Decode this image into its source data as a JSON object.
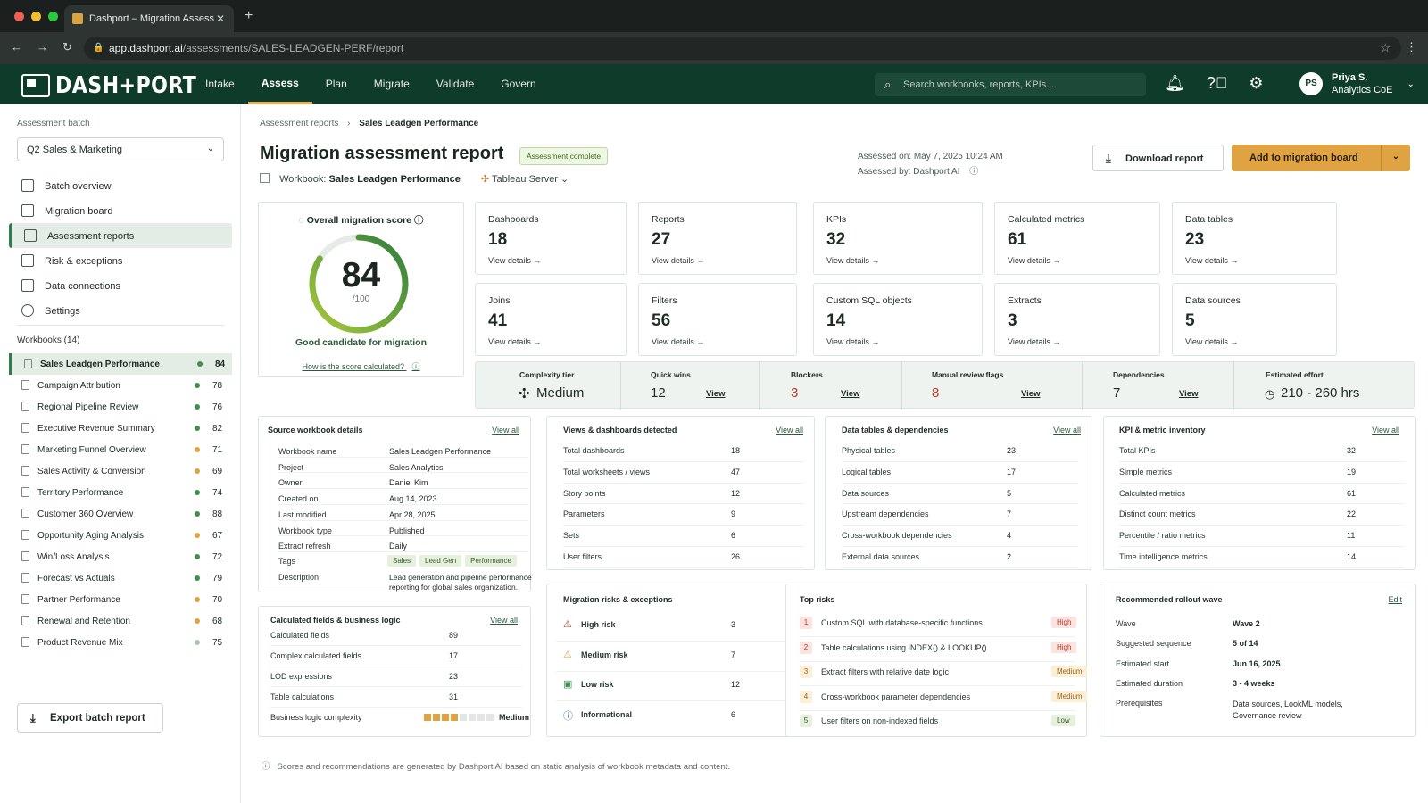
{
  "browser": {
    "tab_title": "Dashport – Migration Assess",
    "url_host": "app.dashport.ai",
    "url_path": "/assessments/SALES-LEADGEN-PERF/report"
  },
  "topnav": {
    "logo": "DASH+PORT",
    "items": [
      "Intake",
      "Assess",
      "Plan",
      "Migrate",
      "Validate",
      "Govern"
    ],
    "search_placeholder": "Search workbooks, reports, KPIs...",
    "user_initials": "PS",
    "user_name": "Priya S.",
    "user_role": "Analytics CoE"
  },
  "sidebar": {
    "batch_label": "Assessment batch",
    "batch_value": "Q2 Sales & Marketing",
    "nav": [
      "Batch overview",
      "Migration board",
      "Assessment reports",
      "Risk & exceptions",
      "Data connections",
      "Settings"
    ],
    "workbooks_label": "Workbooks (14)",
    "workbooks": [
      {
        "name": "Sales Leadgen Performance",
        "score": "84",
        "color": "#3f8f4f"
      },
      {
        "name": "Campaign Attribution",
        "score": "78",
        "color": "#3f8f4f"
      },
      {
        "name": "Regional Pipeline Review",
        "score": "76",
        "color": "#3f8f4f"
      },
      {
        "name": "Executive Revenue Summary",
        "score": "82",
        "color": "#3f8f4f"
      },
      {
        "name": "Marketing Funnel Overview",
        "score": "71",
        "color": "#e0a344"
      },
      {
        "name": "Sales Activity & Conversion",
        "score": "69",
        "color": "#e0a344"
      },
      {
        "name": "Territory Performance",
        "score": "74",
        "color": "#3f8f4f"
      },
      {
        "name": "Customer 360 Overview",
        "score": "88",
        "color": "#3f8f4f"
      },
      {
        "name": "Opportunity Aging Analysis",
        "score": "67",
        "color": "#e0a344"
      },
      {
        "name": "Win/Loss Analysis",
        "score": "72",
        "color": "#3f8f4f"
      },
      {
        "name": "Forecast vs Actuals",
        "score": "79",
        "color": "#3f8f4f"
      },
      {
        "name": "Partner Performance",
        "score": "70",
        "color": "#e0a344"
      },
      {
        "name": "Renewal and Retention",
        "score": "68",
        "color": "#e0a344"
      },
      {
        "name": "Product Revenue Mix",
        "score": "75",
        "color": "#a9c7b0"
      }
    ],
    "export_label": "Export batch report"
  },
  "header": {
    "crumb_parent": "Assessment reports",
    "crumb_current": "Sales Leadgen Performance",
    "title": "Migration assessment report",
    "badge": "Assessment complete",
    "workbook_label": "Workbook:",
    "workbook_name": "Sales Leadgen Performance",
    "server": "Tableau Server",
    "assessed_on": "Assessed on: May 7, 2025 10:24 AM",
    "assessed_by": "Assessed by: Dashport AI",
    "download": "Download report",
    "add": "Add to migration board"
  },
  "score": {
    "title": "Overall migration score",
    "value": 84,
    "max": "/100",
    "verdict": "Good candidate for migration",
    "how": "How is the score calculated?"
  },
  "metrics": [
    {
      "label": "Dashboards",
      "value": "18"
    },
    {
      "label": "Reports",
      "value": "27"
    },
    {
      "label": "KPIs",
      "value": "32"
    },
    {
      "label": "Calculated metrics",
      "value": "61"
    },
    {
      "label": "Data tables",
      "value": "23"
    },
    {
      "label": "Joins",
      "value": "41"
    },
    {
      "label": "Filters",
      "value": "56"
    },
    {
      "label": "Custom SQL objects",
      "value": "14"
    },
    {
      "label": "Extracts",
      "value": "3"
    },
    {
      "label": "Data sources",
      "value": "5"
    }
  ],
  "view_details": "View details →",
  "strip": {
    "complexity_label": "Complexity tier",
    "complexity_value": "Medium",
    "quick_label": "Quick wins",
    "quick_value": "12",
    "blockers_label": "Blockers",
    "blockers_value": "3",
    "manual_label": "Manual review flags",
    "manual_value": "8",
    "deps_label": "Dependencies",
    "deps_value": "7",
    "effort_label": "Estimated effort",
    "effort_value": "210 - 260 hrs",
    "view": "View"
  },
  "view_all": "View all",
  "source": {
    "title": "Source workbook details",
    "rows": [
      {
        "k": "Workbook name",
        "v": "Sales Leadgen Performance"
      },
      {
        "k": "Project",
        "v": "Sales Analytics"
      },
      {
        "k": "Owner",
        "v": "Daniel Kim"
      },
      {
        "k": "Created on",
        "v": "Aug 14, 2023"
      },
      {
        "k": "Last modified",
        "v": "Apr 28, 2025"
      },
      {
        "k": "Workbook type",
        "v": "Published"
      },
      {
        "k": "Extract refresh",
        "v": "Daily"
      }
    ],
    "tags_label": "Tags",
    "tags": [
      "Sales",
      "Lead Gen",
      "Performance"
    ],
    "desc_label": "Description",
    "desc": "Lead generation and pipeline performance reporting for global sales organization."
  },
  "views": {
    "title": "Views & dashboards detected",
    "rows": [
      {
        "k": "Total dashboards",
        "v": "18"
      },
      {
        "k": "Total worksheets / views",
        "v": "47"
      },
      {
        "k": "Story points",
        "v": "12"
      },
      {
        "k": "Parameters",
        "v": "9"
      },
      {
        "k": "Sets",
        "v": "6"
      },
      {
        "k": "User filters",
        "v": "26"
      }
    ]
  },
  "tables": {
    "title": "Data tables & dependencies",
    "rows": [
      {
        "k": "Physical tables",
        "v": "23"
      },
      {
        "k": "Logical tables",
        "v": "17"
      },
      {
        "k": "Data sources",
        "v": "5"
      },
      {
        "k": "Upstream dependencies",
        "v": "7"
      },
      {
        "k": "Cross-workbook dependencies",
        "v": "4"
      },
      {
        "k": "External data sources",
        "v": "2"
      }
    ]
  },
  "kpis": {
    "title": "KPI & metric inventory",
    "rows": [
      {
        "k": "Total KPIs",
        "v": "32"
      },
      {
        "k": "Simple metrics",
        "v": "19"
      },
      {
        "k": "Calculated metrics",
        "v": "61"
      },
      {
        "k": "Distinct count metrics",
        "v": "22"
      },
      {
        "k": "Percentile / ratio metrics",
        "v": "11"
      },
      {
        "k": "Time intelligence metrics",
        "v": "14"
      }
    ]
  },
  "calc": {
    "title": "Calculated fields & business logic",
    "rows": [
      {
        "k": "Calculated fields",
        "v": "89"
      },
      {
        "k": "Complex calculated fields",
        "v": "17"
      },
      {
        "k": "LOD expressions",
        "v": "23"
      },
      {
        "k": "Table calculations",
        "v": "31"
      }
    ],
    "complexity_label": "Business logic complexity",
    "complexity_value": "Medium",
    "complexity_level": 0.5
  },
  "risks": {
    "title": "Migration risks & exceptions",
    "rows": [
      {
        "k": "High risk",
        "v": "3",
        "icon": "warning-icon",
        "color": "#c0392b"
      },
      {
        "k": "Medium risk",
        "v": "7",
        "icon": "warning-icon",
        "color": "#e0a344"
      },
      {
        "k": "Low risk",
        "v": "12",
        "icon": "check-icon",
        "color": "#3f8f4f"
      },
      {
        "k": "Informational",
        "v": "6",
        "icon": "info-icon",
        "color": "#3a6fb0"
      }
    ]
  },
  "toprisks": {
    "title": "Top risks",
    "rows": [
      {
        "n": "1",
        "t": "Custom SQL with database-specific functions",
        "s": "High"
      },
      {
        "n": "2",
        "t": "Table calculations using INDEX() & LOOKUP()",
        "s": "High"
      },
      {
        "n": "3",
        "t": "Extract filters with relative date logic",
        "s": "Medium"
      },
      {
        "n": "4",
        "t": "Cross-workbook parameter dependencies",
        "s": "Medium"
      },
      {
        "n": "5",
        "t": "User filters on non-indexed fields",
        "s": "Low"
      }
    ]
  },
  "rollout": {
    "title": "Recommended rollout wave",
    "edit": "Edit",
    "rows": [
      {
        "k": "Wave",
        "v": "Wave 2"
      },
      {
        "k": "Suggested sequence",
        "v": "5 of 14"
      },
      {
        "k": "Estimated start",
        "v": "Jun 16, 2025"
      },
      {
        "k": "Estimated duration",
        "v": "3 - 4 weeks"
      },
      {
        "k": "Prerequisites",
        "v": "Data sources, LookML models, Governance review"
      }
    ]
  },
  "footer": "Scores and recommendations are generated by Dashport AI based on static analysis of workbook metadata and content."
}
